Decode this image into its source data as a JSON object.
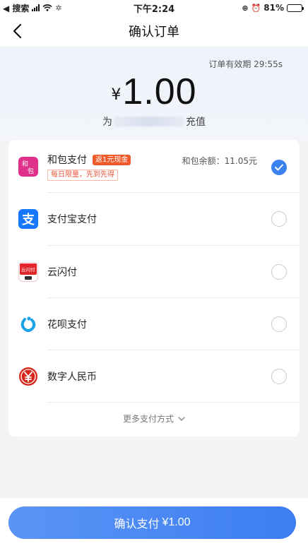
{
  "status_bar": {
    "back_app": "◀ 搜索",
    "time": "下午2:24",
    "battery_text": "81%",
    "battery_level": 0.81
  },
  "nav": {
    "title": "确认订单"
  },
  "order": {
    "expire_label": "订单有效期",
    "expire_time": "29:55s",
    "currency": "¥",
    "amount": "1.00",
    "sub_prefix": "为",
    "sub_suffix": "充值"
  },
  "methods": [
    {
      "name": "和包支付",
      "icon": "hebao-logo-icon",
      "badge": "返1元现金",
      "tag": "每日限量，先到先得",
      "balance_label": "和包余额：",
      "balance_value": "11.05元",
      "selected": true
    },
    {
      "name": "支付宝支付",
      "icon": "alipay-logo-icon",
      "selected": false
    },
    {
      "name": "云闪付",
      "icon": "unionpay-quickpass-logo-icon",
      "selected": false
    },
    {
      "name": "花呗支付",
      "icon": "huabei-logo-icon",
      "selected": false
    },
    {
      "name": "数字人民币",
      "icon": "digital-rmb-logo-icon",
      "selected": false
    }
  ],
  "more_label": "更多支付方式",
  "pay_button": {
    "label": "确认支付",
    "amount": "¥1.00"
  },
  "colors": {
    "accent": "#3a82f0",
    "badge": "#f05a2a",
    "hebao": "#e0318a",
    "alipay": "#1677ff",
    "unionpay": "#e3242b",
    "huabei": "#1aa3e8",
    "digital_rmb": "#d9261c"
  }
}
